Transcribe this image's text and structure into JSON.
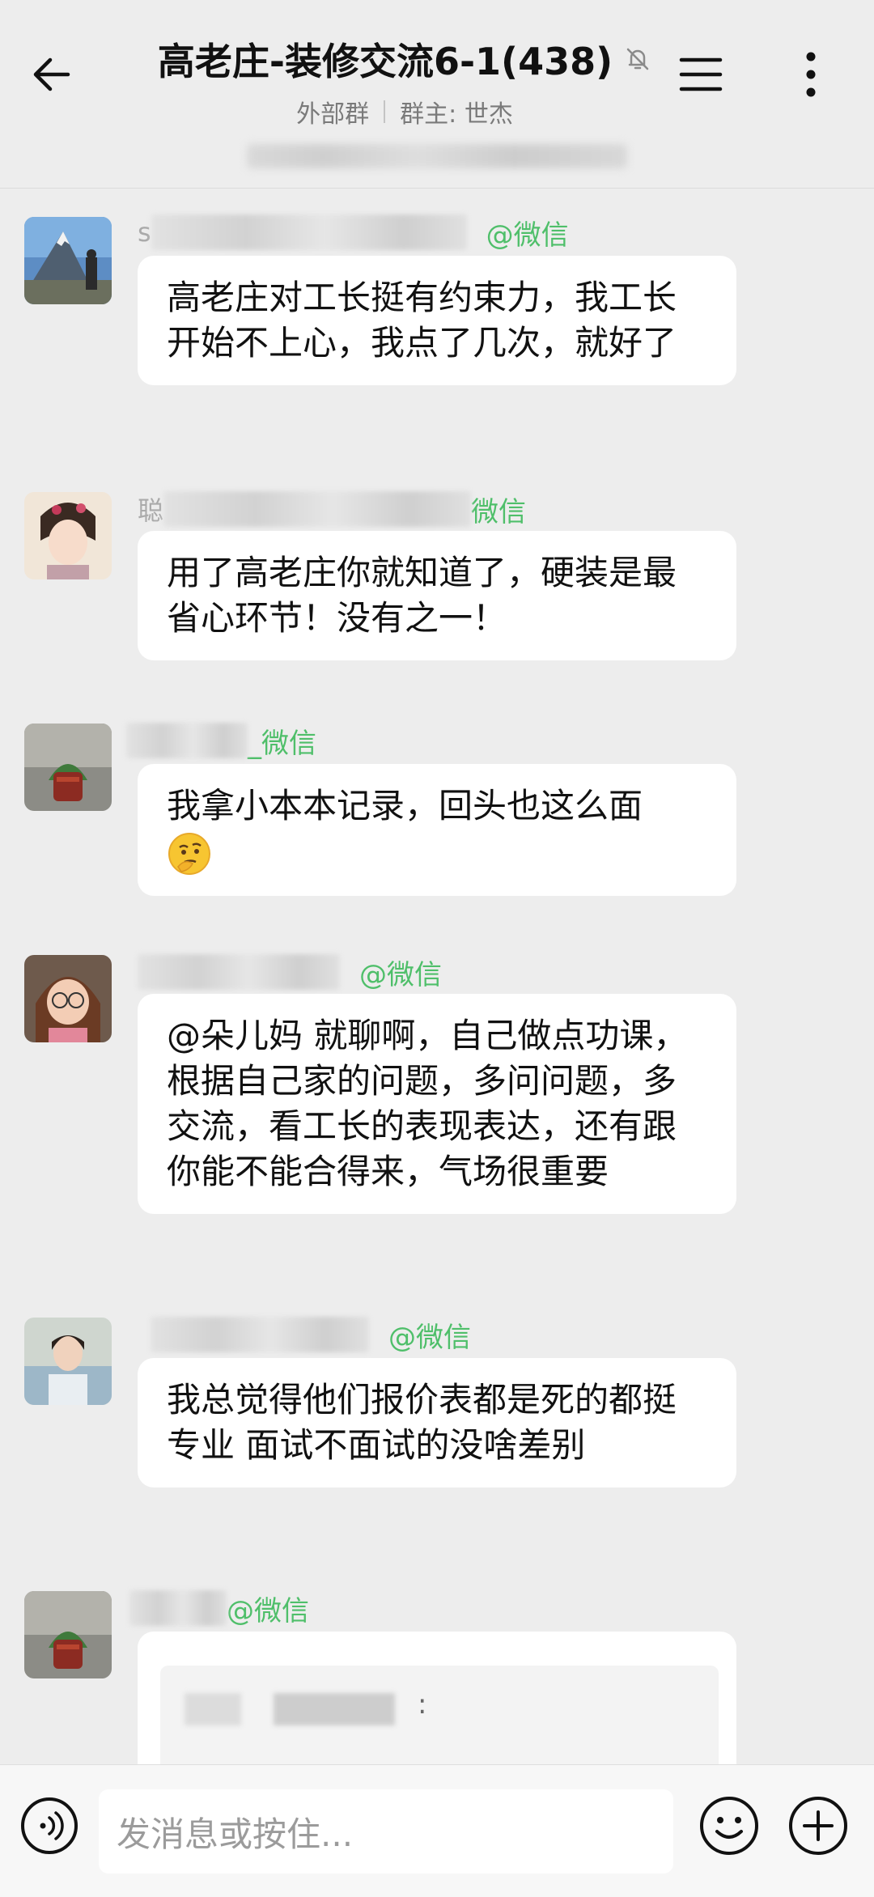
{
  "header": {
    "title": "高老庄-装修交流6-1(438)",
    "group_type": "外部群",
    "owner": "群主: 世杰"
  },
  "messages": [
    {
      "sender_prefix": "s",
      "source": "@微信",
      "text": "高老庄对工长挺有约束力，我工长开始不上心，我点了几次，就好了"
    },
    {
      "sender_prefix": "聪",
      "source": "微信",
      "text": "用了高老庄你就知道了，硬装是最省心环节！没有之一！"
    },
    {
      "sender_prefix": "",
      "source": "_微信",
      "text": "我拿小本本记录，回头也这么面",
      "emoji": "thinking-face"
    },
    {
      "sender_prefix": "",
      "source": "@微信",
      "text": "@朵儿妈 就聊啊，自己做点功课，根据自己家的问题，多问问题，多交流，看工长的表现表达，还有跟你能不能合得来，气场很重要"
    },
    {
      "sender_prefix": "",
      "source": "@微信",
      "text": "我总觉得他们报价表都是死的都挺专业 面试不面试的没啥差别"
    },
    {
      "sender_prefix": "",
      "source": "@微信",
      "quote_colon": ":"
    }
  ],
  "input": {
    "placeholder": "发消息或按住..."
  },
  "colors": {
    "background": "#ededed",
    "source_green": "#4fbf6a",
    "bubble": "#ffffff"
  }
}
